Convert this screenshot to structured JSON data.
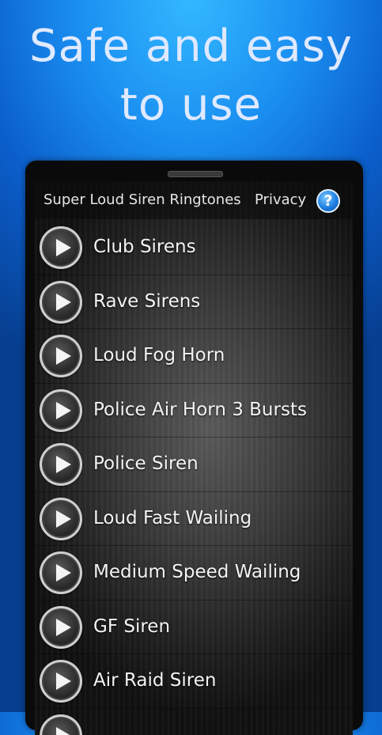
{
  "promo": {
    "line1": "Safe and easy",
    "line2": "to use"
  },
  "header": {
    "title": "Super Loud Siren Ringtones",
    "privacy_label": "Privacy",
    "help_label": "?"
  },
  "ringtones": [
    "Club Sirens",
    "Rave Sirens",
    "Loud Fog Horn",
    "Police Air Horn 3 Bursts",
    "Police Siren",
    "Loud Fast Wailing",
    "Medium Speed Wailing",
    "GF Siren",
    "Air Raid Siren",
    ""
  ],
  "icons": {
    "play": "play-button-icon",
    "help": "help-icon"
  },
  "colors": {
    "background": "#1a8ef0",
    "help_button": "#1f7fe0",
    "text": "#f4f4f4"
  }
}
